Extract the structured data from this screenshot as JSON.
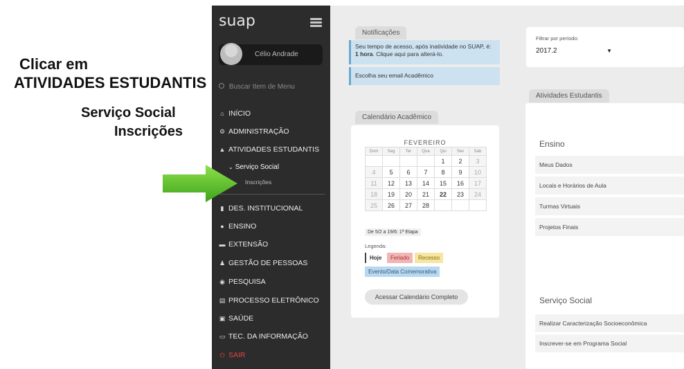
{
  "annotation": {
    "line1": "Clicar em",
    "line2": "ATIVIDADES ESTUDANTIS",
    "line3": "Serviço Social",
    "line4": "Inscrições"
  },
  "sidebar": {
    "logo": "suap",
    "user_name": "Célio Andrade",
    "search_placeholder": "Buscar Item de Menu",
    "items": [
      {
        "label": "INÍCIO",
        "icon": "home-icon"
      },
      {
        "label": "ADMINISTRAÇÃO",
        "icon": "gears-icon"
      },
      {
        "label": "ATIVIDADES ESTUDANTIS",
        "icon": "graduation-icon"
      },
      {
        "label": "DES. INSTITUCIONAL",
        "icon": "bar-chart-icon"
      },
      {
        "label": "ENSINO",
        "icon": "clock-icon"
      },
      {
        "label": "EXTENSÃO",
        "icon": "bed-icon"
      },
      {
        "label": "GESTÃO DE PESSOAS",
        "icon": "user-icon"
      },
      {
        "label": "PESQUISA",
        "icon": "compass-icon"
      },
      {
        "label": "PROCESSO ELETRÔNICO",
        "icon": "file-icon"
      },
      {
        "label": "SAÚDE",
        "icon": "med-icon"
      },
      {
        "label": "TEC. DA INFORMAÇÃO",
        "icon": "monitor-icon"
      },
      {
        "label": "SAIR",
        "icon": "power-icon"
      }
    ],
    "submenu": {
      "label": "Serviço Social",
      "child": "Inscrições"
    }
  },
  "notifications": {
    "tab": "Notificações",
    "msg1_a": "Seu tempo de acesso, após inatividade no SUAP, é: ",
    "msg1_b": "1 hora",
    "msg1_c": ". Clique aqui para alterá-lo.",
    "msg2": "Escolha seu email Acadêmico"
  },
  "calendar": {
    "tab": "Calendário Acadêmico",
    "month": "FEVEREIRO",
    "weekdays": [
      "Dom",
      "Seg",
      "Ter",
      "Qua",
      "Qui",
      "Sex",
      "Sab"
    ],
    "weeks": [
      [
        "",
        "",
        "",
        "",
        "1",
        "2",
        "3"
      ],
      [
        "4",
        "5",
        "6",
        "7",
        "8",
        "9",
        "10"
      ],
      [
        "11",
        "12",
        "13",
        "14",
        "15",
        "16",
        "17"
      ],
      [
        "18",
        "19",
        "20",
        "21",
        "22",
        "23",
        "24"
      ],
      [
        "25",
        "26",
        "27",
        "28",
        "",
        "",
        ""
      ]
    ],
    "etapa": "De 5/2 a 19/6: 1ª Etapa",
    "legenda": "Legenda:",
    "leg_hoje": "Hoje",
    "leg_feriado": "Feriado",
    "leg_recesso": "Recesso",
    "leg_evento": "Evento/Data Comemorativa",
    "button": "Acessar Calendário Completo"
  },
  "filter": {
    "label": "Filtrar por período:",
    "value": "2017.2"
  },
  "atividades": {
    "tab": "Atividades Estudantis",
    "ensino_title": "Ensino",
    "ensino_links": [
      "Meus Dados",
      "Locais e Horários de Aula",
      "Turmas Virtuais",
      "Projetos Finais"
    ],
    "servico_title": "Serviço Social",
    "servico_links": [
      "Realizar Caracterização Socioeconômica",
      "Inscrever-se em Programa Social"
    ]
  },
  "colors": {
    "sidebar_bg": "#2c2c2c",
    "notif_bg": "#cde2f0",
    "feriado": "#f2b5b5",
    "recesso": "#f5e6a3",
    "evento": "#b9d7ee",
    "sair": "#e04545",
    "arrow": "#5cc32c"
  }
}
